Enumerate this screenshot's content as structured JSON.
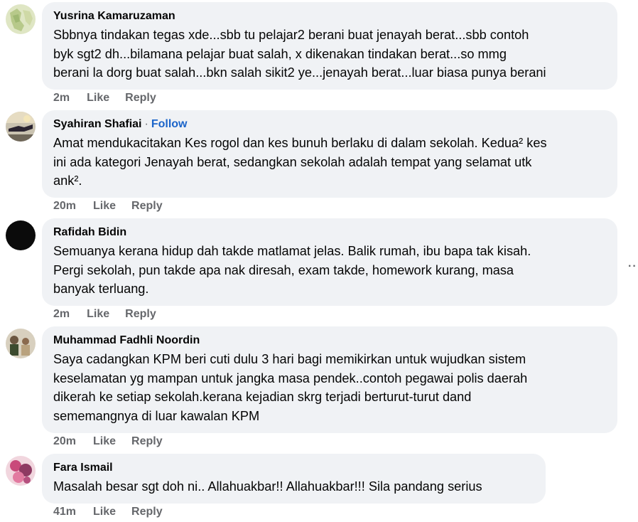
{
  "comments": [
    {
      "name": "Yusrina Kamaruzaman",
      "follow": "",
      "text": "Sbbnya tindakan tegas xde...sbb tu pelajar2 berani buat jenayah berat...sbb contoh\nbyk sgt2 dh...bilamana pelajar buat salah, x dikenakan tindakan berat...so mmg\nberani la dorg buat salah...bkn salah sikit2 ye...jenayah berat...luar biasa punya berani",
      "time": "2m",
      "like": "Like",
      "reply": "Reply"
    },
    {
      "name": "Syahiran Shafiai",
      "follow": "Follow",
      "text": "Amat mendukacitakan Kes rogol dan kes bunuh berlaku di dalam sekolah. Kedua² kes\nini ada kategori Jenayah berat, sedangkan sekolah adalah tempat yang selamat utk\nank².",
      "time": "20m",
      "like": "Like",
      "reply": "Reply"
    },
    {
      "name": "Rafidah Bidin",
      "follow": "",
      "text": "Semuanya kerana hidup dah takde matlamat jelas. Balik rumah, ibu bapa tak kisah.\nPergi sekolah, pun takde apa nak diresah, exam takde, homework kurang, masa\nbanyak terluang.",
      "time": "2m",
      "like": "Like",
      "reply": "Reply"
    },
    {
      "name": "Muhammad Fadhli Noordin",
      "follow": "",
      "text": "Saya cadangkan KPM beri cuti dulu 3 hari bagi memikirkan untuk wujudkan sistem\nkeselamatan yg mampan untuk jangka masa pendek..contoh pegawai polis daerah\ndikerah ke setiap sekolah.kerana kejadian skrg terjadi berturut-turut dand\nsememangnya di luar kawalan KPM",
      "time": "20m",
      "like": "Like",
      "reply": "Reply"
    },
    {
      "name": "Fara Ismail",
      "follow": "",
      "text": "Masalah besar sgt doh ni.. Allahuakbar!! Allahuakbar!!! Sila pandang serius",
      "time": "41m",
      "like": "Like",
      "reply": "Reply"
    }
  ],
  "more_icon": "more-dots-icon"
}
